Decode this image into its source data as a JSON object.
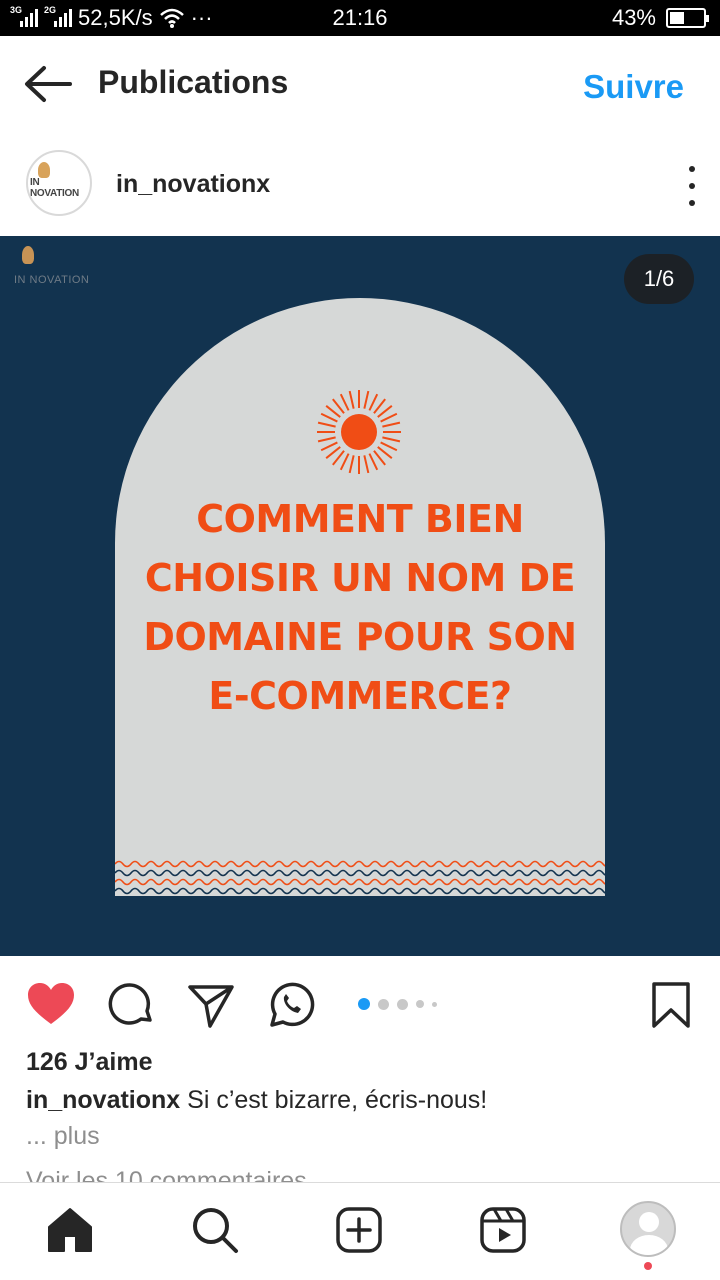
{
  "status_bar": {
    "network_1": "3G",
    "network_2": "2G",
    "speed": "52,5K/s",
    "more": "···",
    "time": "21:16",
    "battery": "43%",
    "battery_level": 0.43
  },
  "header": {
    "title": "Publications",
    "follow_label": "Suivre"
  },
  "author": {
    "username": "in_novationx",
    "avatar_logo_text": "IN NOVATION"
  },
  "post": {
    "counter": "1/6",
    "brand_watermark": "IN NOVATION",
    "headline": "COMMENT BIEN\nCHOISIR UN NOM DE\nDOMAINE POUR SON\nE-COMMERCE?",
    "colors": {
      "background": "#12334f",
      "arch": "#d6d8d7",
      "accent": "#f04d15"
    },
    "carousel_pages": 6,
    "current_page": 1
  },
  "actions": {
    "liked": true,
    "like_color": "#ed4956",
    "icons": [
      "heart-icon",
      "comment-icon",
      "share-icon",
      "whatsapp-icon",
      "bookmark-icon"
    ]
  },
  "details": {
    "likes": "126 J’aime",
    "caption_user": "in_novationx",
    "caption_text": "Si c’est bizarre, écris-nous!",
    "more": "... plus",
    "comments": "Voir les 10 commentaires"
  },
  "nav": {
    "items": [
      "home-icon",
      "search-icon",
      "create-icon",
      "reels-icon",
      "profile-avatar"
    ],
    "active": "home-icon"
  }
}
